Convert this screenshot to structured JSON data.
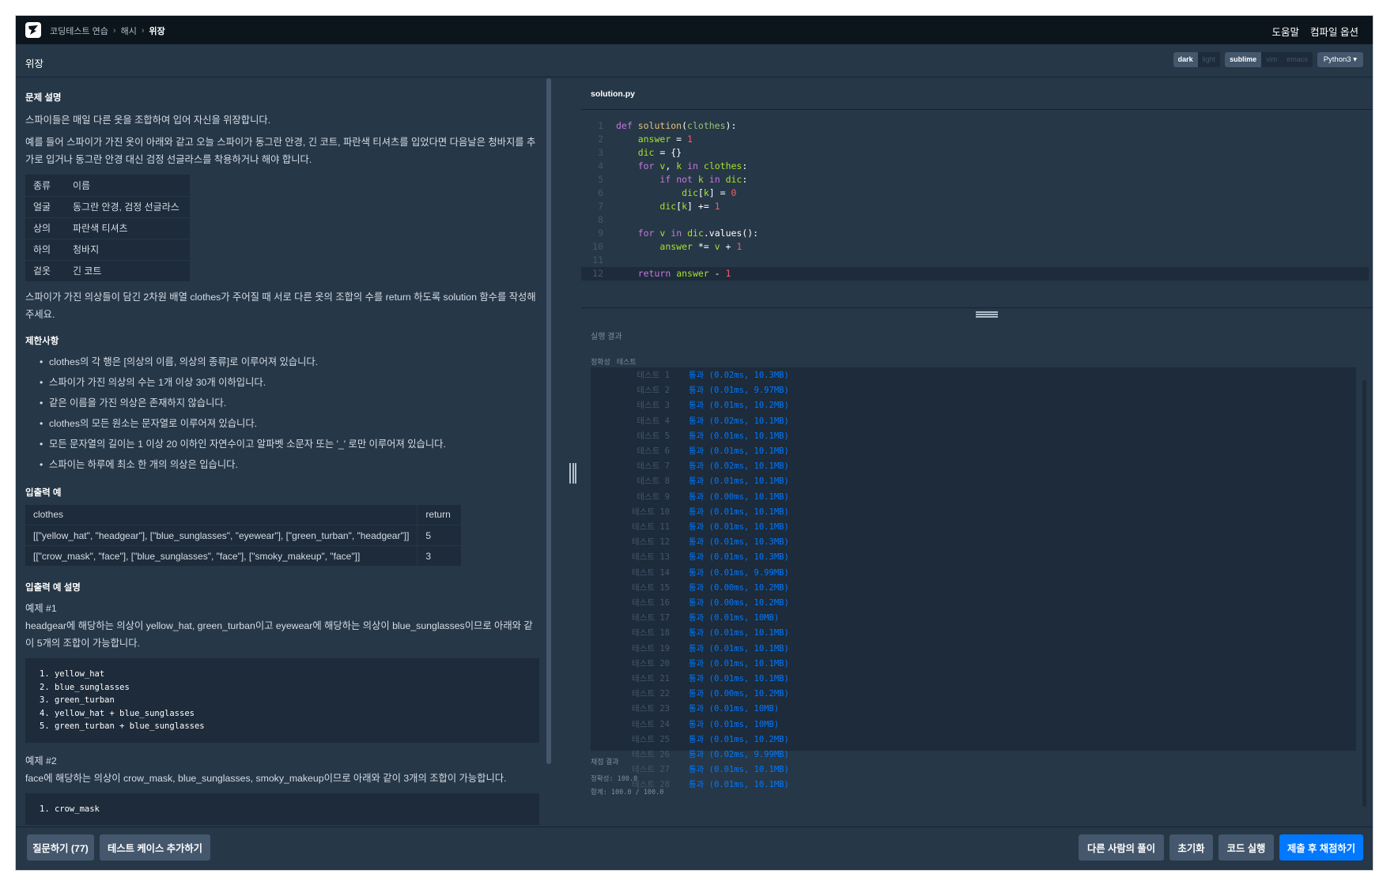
{
  "nav": {
    "breadcrumbs": [
      "코딩테스트 연습",
      "해시",
      "위장"
    ],
    "help": "도움말",
    "compile_options": "컴파일 옵션"
  },
  "title": "위장",
  "toggles": {
    "theme": [
      "dark",
      "light"
    ],
    "theme_selected": "dark",
    "keymap": [
      "sublime",
      "vim",
      "emacs"
    ],
    "keymap_selected": "sublime",
    "language": "Python3"
  },
  "problem": {
    "desc_heading": "문제 설명",
    "p1": "스파이들은 매일 다른 옷을 조합하여 입어 자신을 위장합니다.",
    "p2": "예를 들어 스파이가 가진 옷이 아래와 같고 오늘 스파이가 동그란 안경, 긴 코트, 파란색 티셔츠를 입었다면 다음날은 청바지를 추가로 입거나 동그란 안경 대신 검정 선글라스를 착용하거나 해야 합니다.",
    "table": [
      [
        "종류",
        "이름"
      ],
      [
        "얼굴",
        "동그란 안경, 검정 선글라스"
      ],
      [
        "상의",
        "파란색 티셔츠"
      ],
      [
        "하의",
        "청바지"
      ],
      [
        "겉옷",
        "긴 코트"
      ]
    ],
    "p3": "스파이가 가진 의상들이 담긴 2차원 배열 clothes가 주어질 때 서로 다른 옷의 조합의 수를 return 하도록 solution 함수를 작성해주세요.",
    "limits_heading": "제한사항",
    "limits": [
      "clothes의 각 행은 [의상의 이름, 의상의 종류]로 이루어져 있습니다.",
      "스파이가 가진 의상의 수는 1개 이상 30개 이하입니다.",
      "같은 이름을 가진 의상은 존재하지 않습니다.",
      "clothes의 모든 원소는 문자열로 이루어져 있습니다.",
      "모든 문자열의 길이는 1 이상 20 이하인 자연수이고 알파벳 소문자 또는 '_' 로만 이루어져 있습니다.",
      "스파이는 하루에 최소 한 개의 의상은 입습니다."
    ],
    "io_heading": "입출력 예",
    "io_header": [
      "clothes",
      "return"
    ],
    "io_rows": [
      [
        "[[\"yellow_hat\", \"headgear\"], [\"blue_sunglasses\", \"eyewear\"], [\"green_turban\", \"headgear\"]]",
        "5"
      ],
      [
        "[[\"crow_mask\", \"face\"], [\"blue_sunglasses\", \"face\"], [\"smoky_makeup\", \"face\"]]",
        "3"
      ]
    ],
    "io_desc_heading": "입출력 예 설명",
    "ex1_title": "예제 #1",
    "ex1_text": "headgear에 해당하는 의상이 yellow_hat, green_turban이고 eyewear에 해당하는 의상이 blue_sunglasses이므로 아래와 같이 5개의 조합이 가능합니다.",
    "ex1_code": "1. yellow_hat\n2. blue_sunglasses\n3. green_turban\n4. yellow_hat + blue_sunglasses\n5. green_turban + blue_sunglasses",
    "ex2_title": "예제 #2",
    "ex2_text": "face에 해당하는 의상이 crow_mask, blue_sunglasses, smoky_makeup이므로 아래와 같이 3개의 조합이 가능합니다.",
    "ex2_code": "1. crow_mask"
  },
  "editor": {
    "filename": "solution.py",
    "lines": [
      "def solution(clothes):",
      "    answer = 1",
      "    dic = {}",
      "    for v, k in clothes:",
      "        if not k in dic:",
      "            dic[k] = 0",
      "        dic[k] += 1",
      "",
      "    for v in dic.values():",
      "        answer *= v + 1",
      "",
      "    return answer - 1"
    ]
  },
  "result": {
    "label": "실행 결과",
    "tabs": [
      "정확성",
      "테스트"
    ],
    "tests": [
      [
        "테스트 1",
        "통과 (0.02ms, 10.3MB)"
      ],
      [
        "테스트 2",
        "통과 (0.01ms, 9.97MB)"
      ],
      [
        "테스트 3",
        "통과 (0.01ms, 10.2MB)"
      ],
      [
        "테스트 4",
        "통과 (0.02ms, 10.1MB)"
      ],
      [
        "테스트 5",
        "통과 (0.01ms, 10.1MB)"
      ],
      [
        "테스트 6",
        "통과 (0.01ms, 10.1MB)"
      ],
      [
        "테스트 7",
        "통과 (0.02ms, 10.1MB)"
      ],
      [
        "테스트 8",
        "통과 (0.01ms, 10.1MB)"
      ],
      [
        "테스트 9",
        "통과 (0.00ms, 10.1MB)"
      ],
      [
        "테스트 10",
        "통과 (0.01ms, 10.1MB)"
      ],
      [
        "테스트 11",
        "통과 (0.01ms, 10.1MB)"
      ],
      [
        "테스트 12",
        "통과 (0.01ms, 10.3MB)"
      ],
      [
        "테스트 13",
        "통과 (0.01ms, 10.3MB)"
      ],
      [
        "테스트 14",
        "통과 (0.01ms, 9.99MB)"
      ],
      [
        "테스트 15",
        "통과 (0.00ms, 10.2MB)"
      ],
      [
        "테스트 16",
        "통과 (0.00ms, 10.2MB)"
      ],
      [
        "테스트 17",
        "통과 (0.01ms, 10MB)"
      ],
      [
        "테스트 18",
        "통과 (0.01ms, 10.1MB)"
      ],
      [
        "테스트 19",
        "통과 (0.01ms, 10.1MB)"
      ],
      [
        "테스트 20",
        "통과 (0.01ms, 10.1MB)"
      ],
      [
        "테스트 21",
        "통과 (0.01ms, 10.1MB)"
      ],
      [
        "테스트 22",
        "통과 (0.00ms, 10.2MB)"
      ],
      [
        "테스트 23",
        "통과 (0.01ms, 10MB)"
      ],
      [
        "테스트 24",
        "통과 (0.01ms, 10MB)"
      ],
      [
        "테스트 25",
        "통과 (0.01ms, 10.2MB)"
      ],
      [
        "테스트 26",
        "통과 (0.02ms, 9.99MB)"
      ],
      [
        "테스트 27",
        "통과 (0.01ms, 10.1MB)"
      ],
      [
        "테스트 28",
        "통과 (0.01ms, 10.1MB)"
      ]
    ],
    "grade_label": "채점 결과",
    "accuracy": "정확성: 100.0",
    "total": "합계: 100.0 / 100.0"
  },
  "buttons": {
    "question": "질문하기 (77)",
    "add_testcase": "테스트 케이스 추가하기",
    "others": "다른 사람의 풀이",
    "reset": "초기화",
    "run": "코드 실행",
    "submit": "제출 후 채점하기"
  },
  "colors": {
    "bg": "#263747",
    "nav": "#0c151c",
    "panel": "#1d2b3a",
    "accent": "#0078ff"
  }
}
